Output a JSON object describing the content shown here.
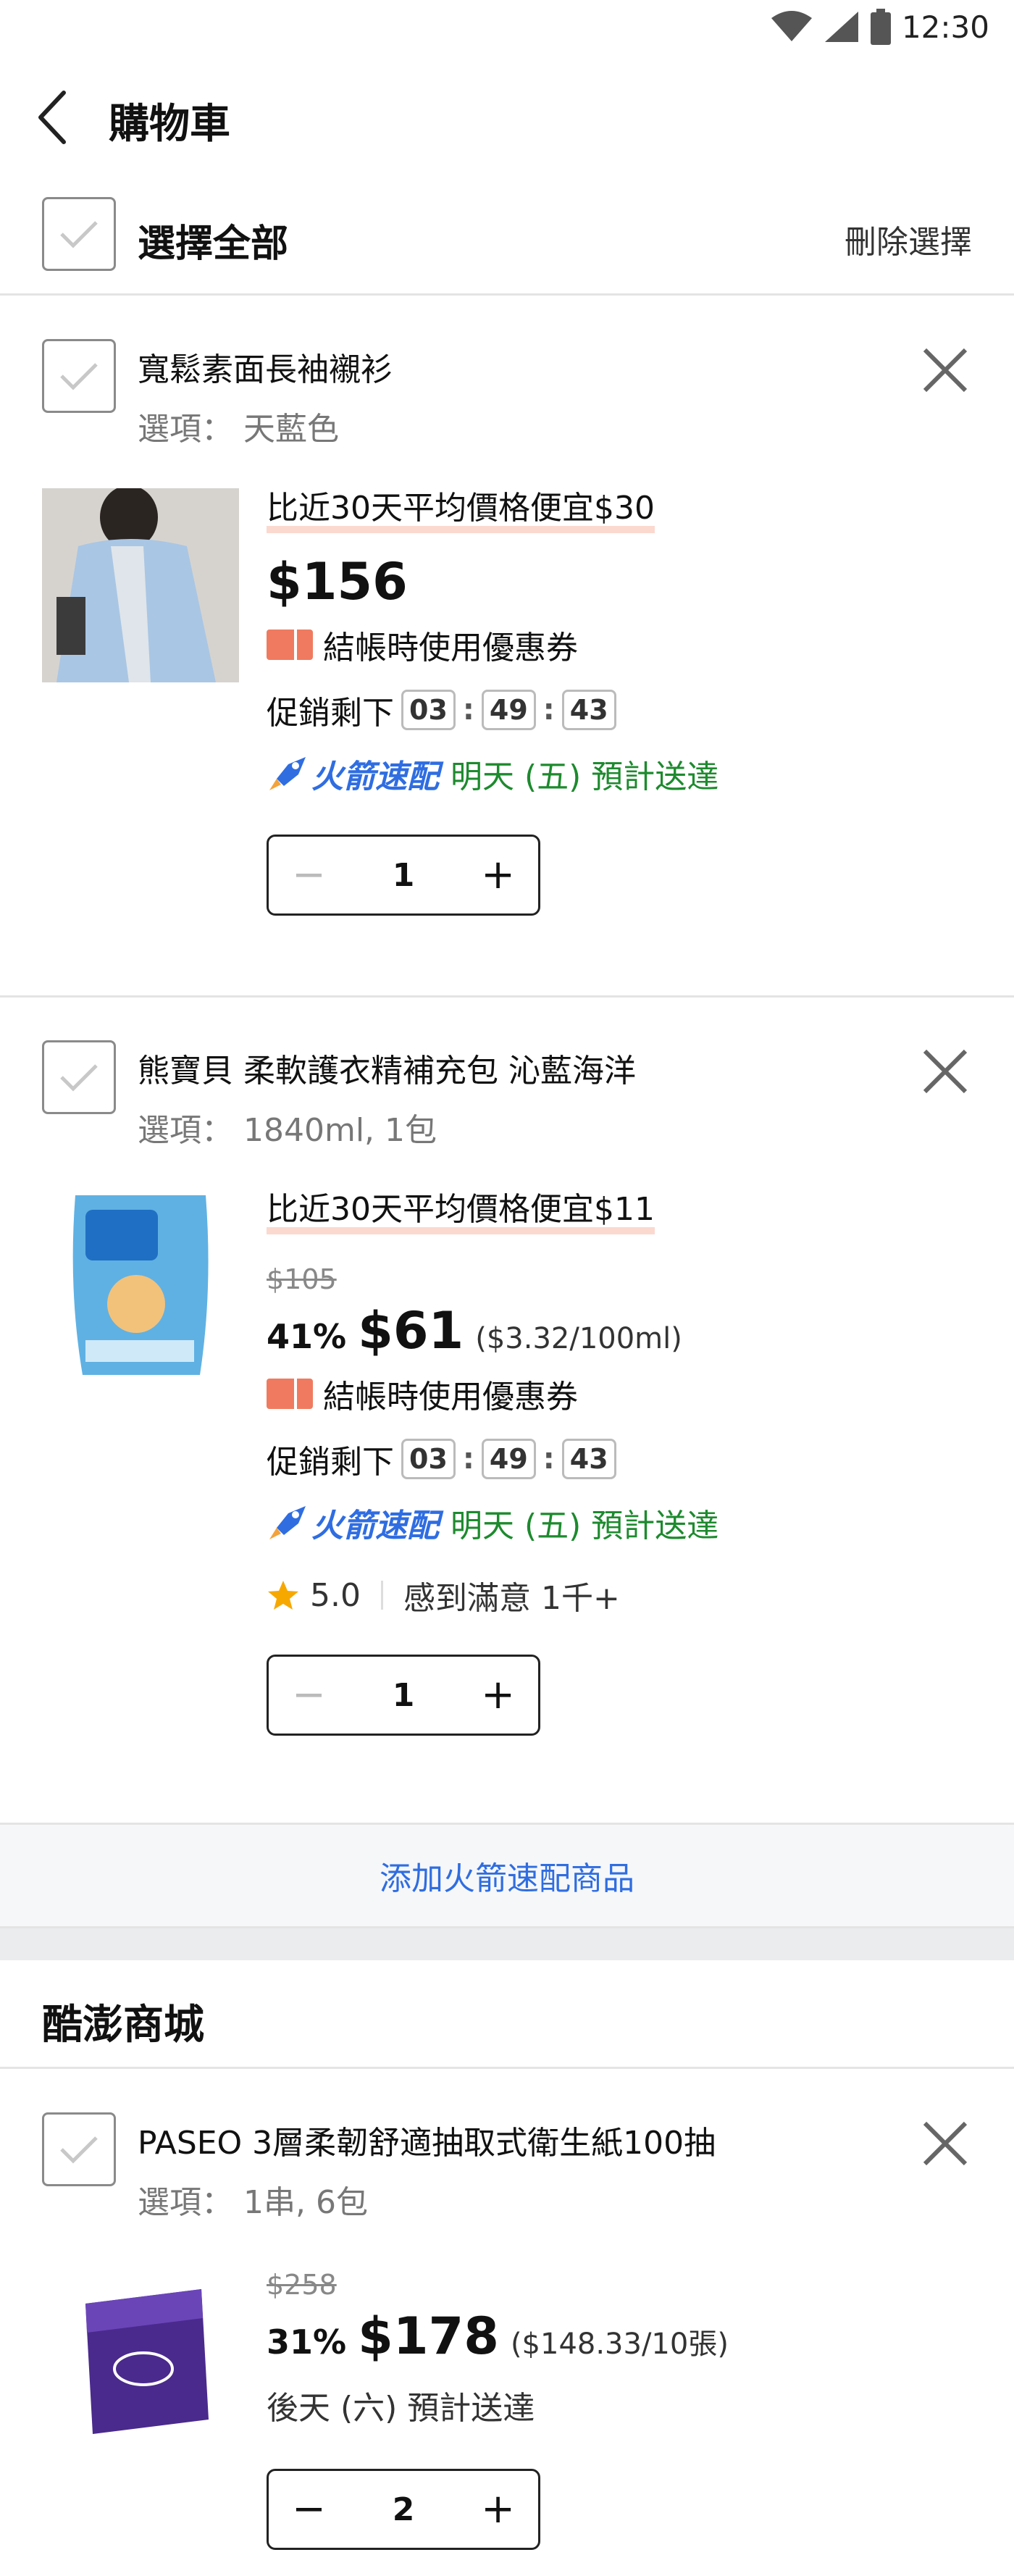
{
  "status": {
    "time": "12:30"
  },
  "header": {
    "title": "購物車"
  },
  "select_all": {
    "label": "選擇全部",
    "delete_label": "刪除選擇"
  },
  "items": [
    {
      "title": "寬鬆素面長袖襯衫",
      "option": "選項： 天藍色",
      "compare": "比近30天平均價格便宜$30",
      "price": "$156",
      "coupon": "結帳時使用優惠券",
      "promo_label": "促銷剩下",
      "timer": [
        "03",
        "49",
        "43"
      ],
      "rocket_label": "火箭速配",
      "delivery": "明天 (五) 預計送達",
      "qty": "1"
    },
    {
      "title": "熊寶貝 柔軟護衣精補充包 沁藍海洋",
      "option": "選項： 1840ml, 1包",
      "compare": "比近30天平均價格便宜$11",
      "original_price": "$105",
      "discount": "41%",
      "price": "$61",
      "unit_price": "($3.32/100ml)",
      "coupon": "結帳時使用優惠券",
      "promo_label": "促銷剩下",
      "timer": [
        "03",
        "49",
        "43"
      ],
      "rocket_label": "火箭速配",
      "delivery": "明天 (五) 預計送達",
      "rating": "5.0",
      "satisfaction": "感到滿意 1千+",
      "qty": "1"
    }
  ],
  "add_rocket": {
    "label": "添加火箭速配商品"
  },
  "seller": {
    "name": "酷澎商城"
  },
  "seller_items": [
    {
      "title": "PASEO 3層柔韌舒適抽取式衛生紙100抽",
      "option": "選項： 1串, 6包",
      "original_price": "$258",
      "discount": "31%",
      "price": "$178",
      "unit_price": "($148.33/10張)",
      "delivery": "後天 (六) 預計送達",
      "qty": "2"
    }
  ],
  "colors": {
    "accent_blue": "#2f6de1",
    "delivery_green": "#1d8a2e",
    "highlight": "#fbd9cf",
    "coupon": "#f07a5f"
  }
}
